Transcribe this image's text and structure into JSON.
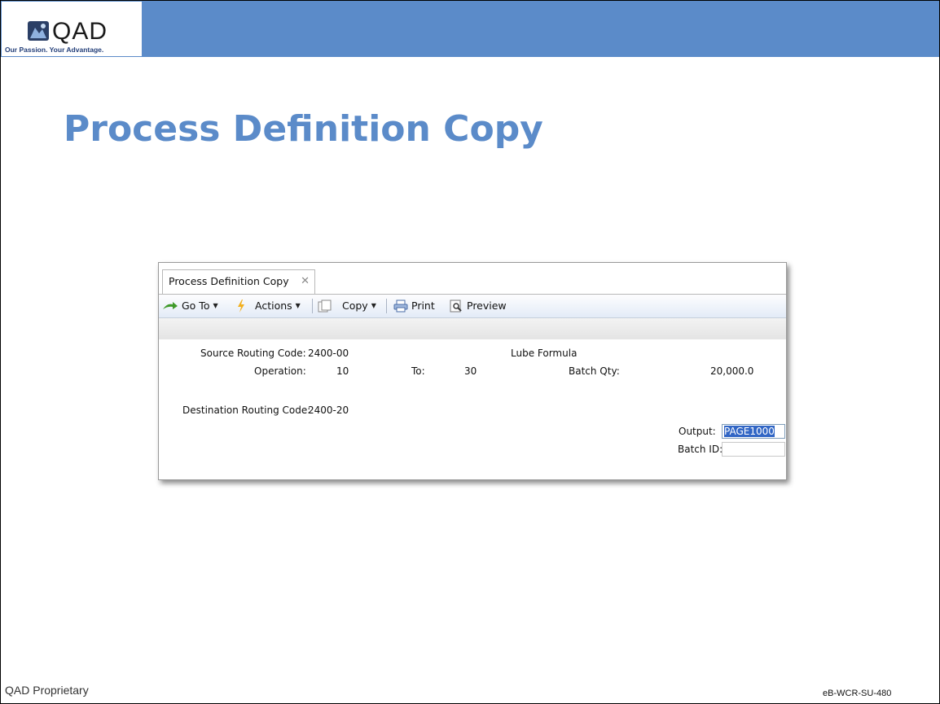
{
  "slide": {
    "logo_text": "QAD",
    "logo_tagline": "Our Passion. Your Advantage.",
    "title": "Process Definition Copy",
    "footer_left": "QAD Proprietary",
    "footer_right": "eB-WCR-SU-480",
    "accent_color": "#5b8bc9"
  },
  "window": {
    "tab_label": "Process Definition Copy",
    "tab_close_glyph": "✕",
    "toolbar": {
      "goto_label": "Go To",
      "actions_label": "Actions",
      "copy_label": "Copy",
      "print_label": "Print",
      "preview_label": "Preview"
    },
    "form": {
      "source_routing_label": "Source Routing Code:",
      "source_routing_value": "2400-00",
      "description": "Lube Formula",
      "operation_label": "Operation:",
      "operation_from": "10",
      "to_label": "To:",
      "operation_to": "30",
      "batch_qty_label": "Batch Qty:",
      "batch_qty_value": "20,000.0",
      "destination_routing_label": "Destination Routing Code:",
      "destination_routing_value": "2400-20",
      "output_label": "Output:",
      "output_value": "PAGE1000",
      "batch_id_label": "Batch ID:",
      "batch_id_value": ""
    }
  }
}
